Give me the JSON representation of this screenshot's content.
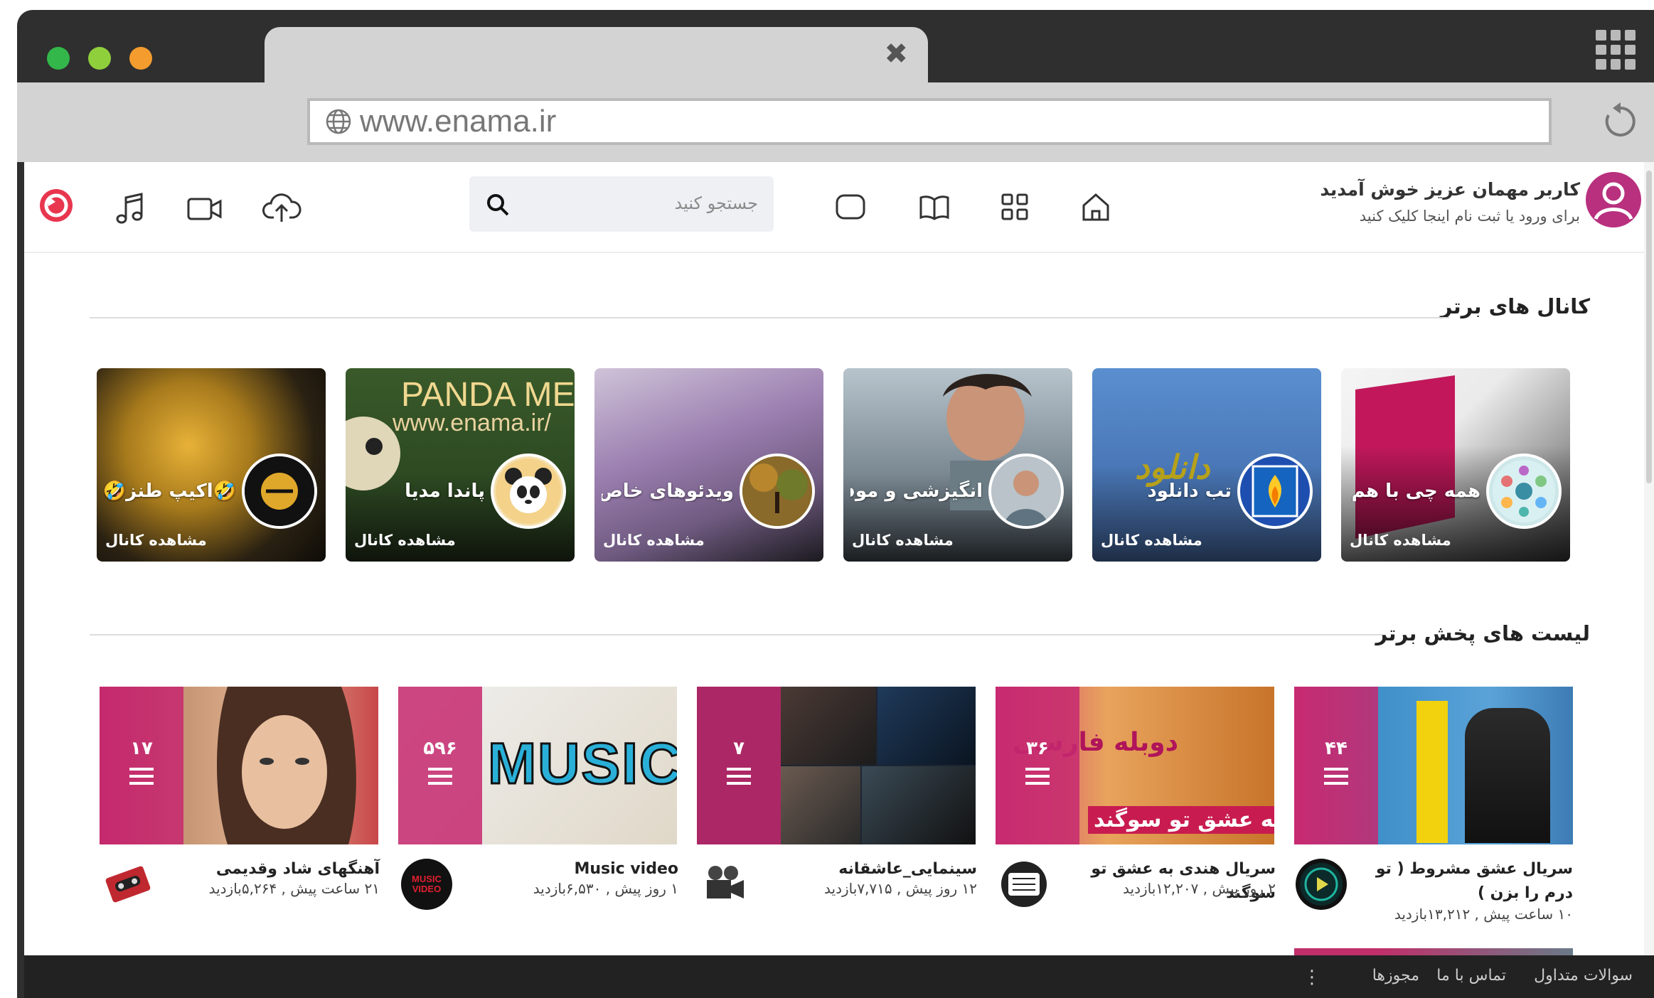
{
  "browser": {
    "url": "www.enama.ir",
    "colors": {
      "close": "#34b74a",
      "minimize": "#8fcf3c",
      "maximize": "#f49c2e"
    },
    "icons": {
      "globe": "globe-icon",
      "reload": "reload-icon",
      "tab_close": "close-icon",
      "apps": "apps-grid-icon"
    }
  },
  "header": {
    "search_placeholder": "جستجو کنید",
    "user_title": "کاربر مهمان عزیز خوش آمدید",
    "user_subtitle": "برای ورود یا ثبت نام اینجا کلیک کنید",
    "icons": [
      "logo-icon",
      "music-icon",
      "video-icon",
      "upload-icon",
      "search-icon",
      "chat-icon",
      "book-icon",
      "apps-icon",
      "home-icon",
      "user-avatar-icon"
    ]
  },
  "channels_section": {
    "title": "کانال های برتر",
    "cards": [
      {
        "name": "همه چی با هم ...",
        "link": "مشاهده کانال",
        "bg": "#c2185b"
      },
      {
        "name": "تب دانلود",
        "link": "مشاهده کانال",
        "bg": "#4a78b8",
        "art": "دانلود"
      },
      {
        "name": "انگیزشی و موفقی...",
        "link": "مشاهده کانال",
        "bg": "#8e9aa5"
      },
      {
        "name": "ویدئوهای خاص...",
        "link": "مشاهده کانال",
        "bg": "#8a6ea0"
      },
      {
        "name": "پاندا مدیا",
        "link": "مشاهده کانال",
        "bg": "#3d5a2a",
        "art": "PANDA ME",
        "art2": "www.enama.ir/"
      },
      {
        "name": "🤣اکیپ طنز🤣",
        "link": "مشاهده کانال",
        "bg": "#8a6a1a"
      }
    ]
  },
  "playlists_section": {
    "title": "لیست های پخش برتر",
    "items": [
      {
        "count": "۴۴",
        "title": "سریال عشق مشروط ( تو درم را بزن )",
        "meta": "۱۰ ساعت پیش , ۱۳,۲۱۲بازدید"
      },
      {
        "count": "۳۶",
        "title": "سریال هندی به عشق تو سوگند",
        "meta": "۲ روز پیش , ۱۲,۲۰۷بازدید",
        "art": "دوبله فارسی",
        "art2": "به عشق تو سوگند"
      },
      {
        "count": "۷",
        "title": "سینمایی_عاشقانه",
        "meta": "۱۲ روز پیش , ۷,۷۱۵بازدید"
      },
      {
        "count": "۵۹۶",
        "title": "Music video",
        "meta": "۱ روز پیش , ۶,۵۳۰بازدید",
        "art": "MUSIC",
        "icon_text": "MUSIC VIDEO"
      },
      {
        "count": "۱۷",
        "title": "آهنگهای شاد وقدیمی",
        "meta": "۲۱ ساعت پیش , ۵,۲۶۴بازدید"
      }
    ]
  },
  "footer": {
    "links": [
      "سوالات متداول",
      "تماس با ما",
      "مجوزها"
    ],
    "more": "⋮"
  }
}
